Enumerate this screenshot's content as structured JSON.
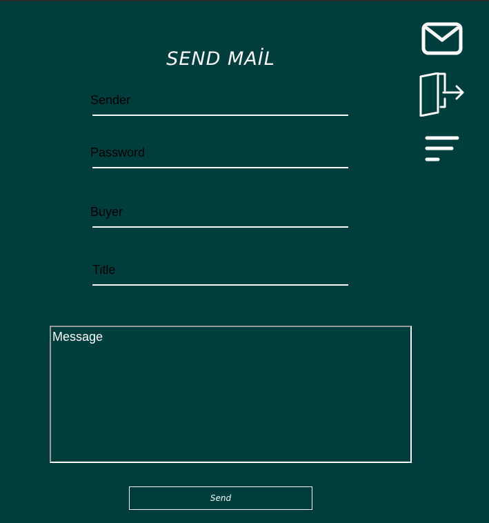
{
  "header": {
    "title": "SEND MAİL"
  },
  "form": {
    "sender_label": "Sender",
    "password_label": "Password",
    "buyer_label": "Buyer",
    "title_label": "Title",
    "message_label": "Message",
    "send_label": "Send"
  },
  "side_nav": {
    "icons": [
      "mail-icon",
      "logout-icon",
      "menu-icon"
    ]
  },
  "colors": {
    "background": "#003e3e",
    "foreground": "#ffffff",
    "label_text": "#000000"
  }
}
